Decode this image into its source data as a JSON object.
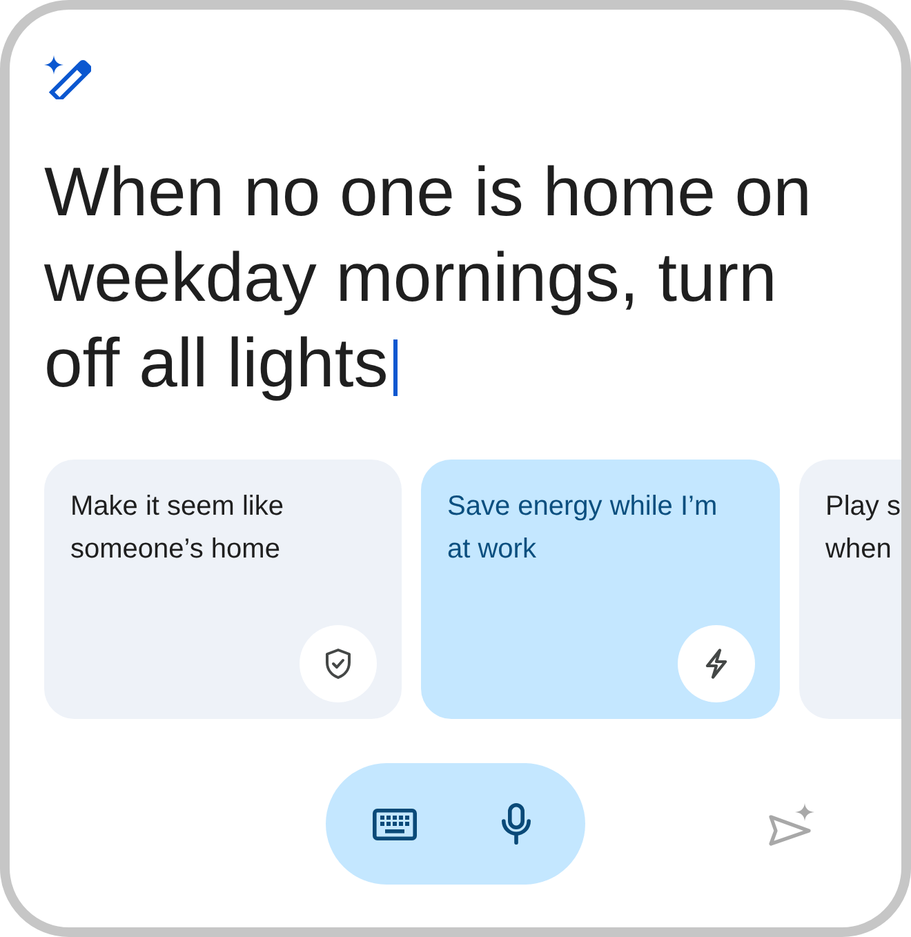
{
  "prompt": {
    "value": "When no one is home on weekday mornings, turn off all lights",
    "focused": true
  },
  "suggestions": [
    {
      "lines": [
        "Make it seem like",
        "someone’s home"
      ],
      "kind": "security",
      "selected": false
    },
    {
      "lines": [
        "Save energy while I’m",
        "at work"
      ],
      "kind": "energy",
      "selected": true
    },
    {
      "lines": [
        "Play s",
        "when"
      ],
      "selected": false
    }
  ],
  "send_button": {
    "disabled": true
  }
}
